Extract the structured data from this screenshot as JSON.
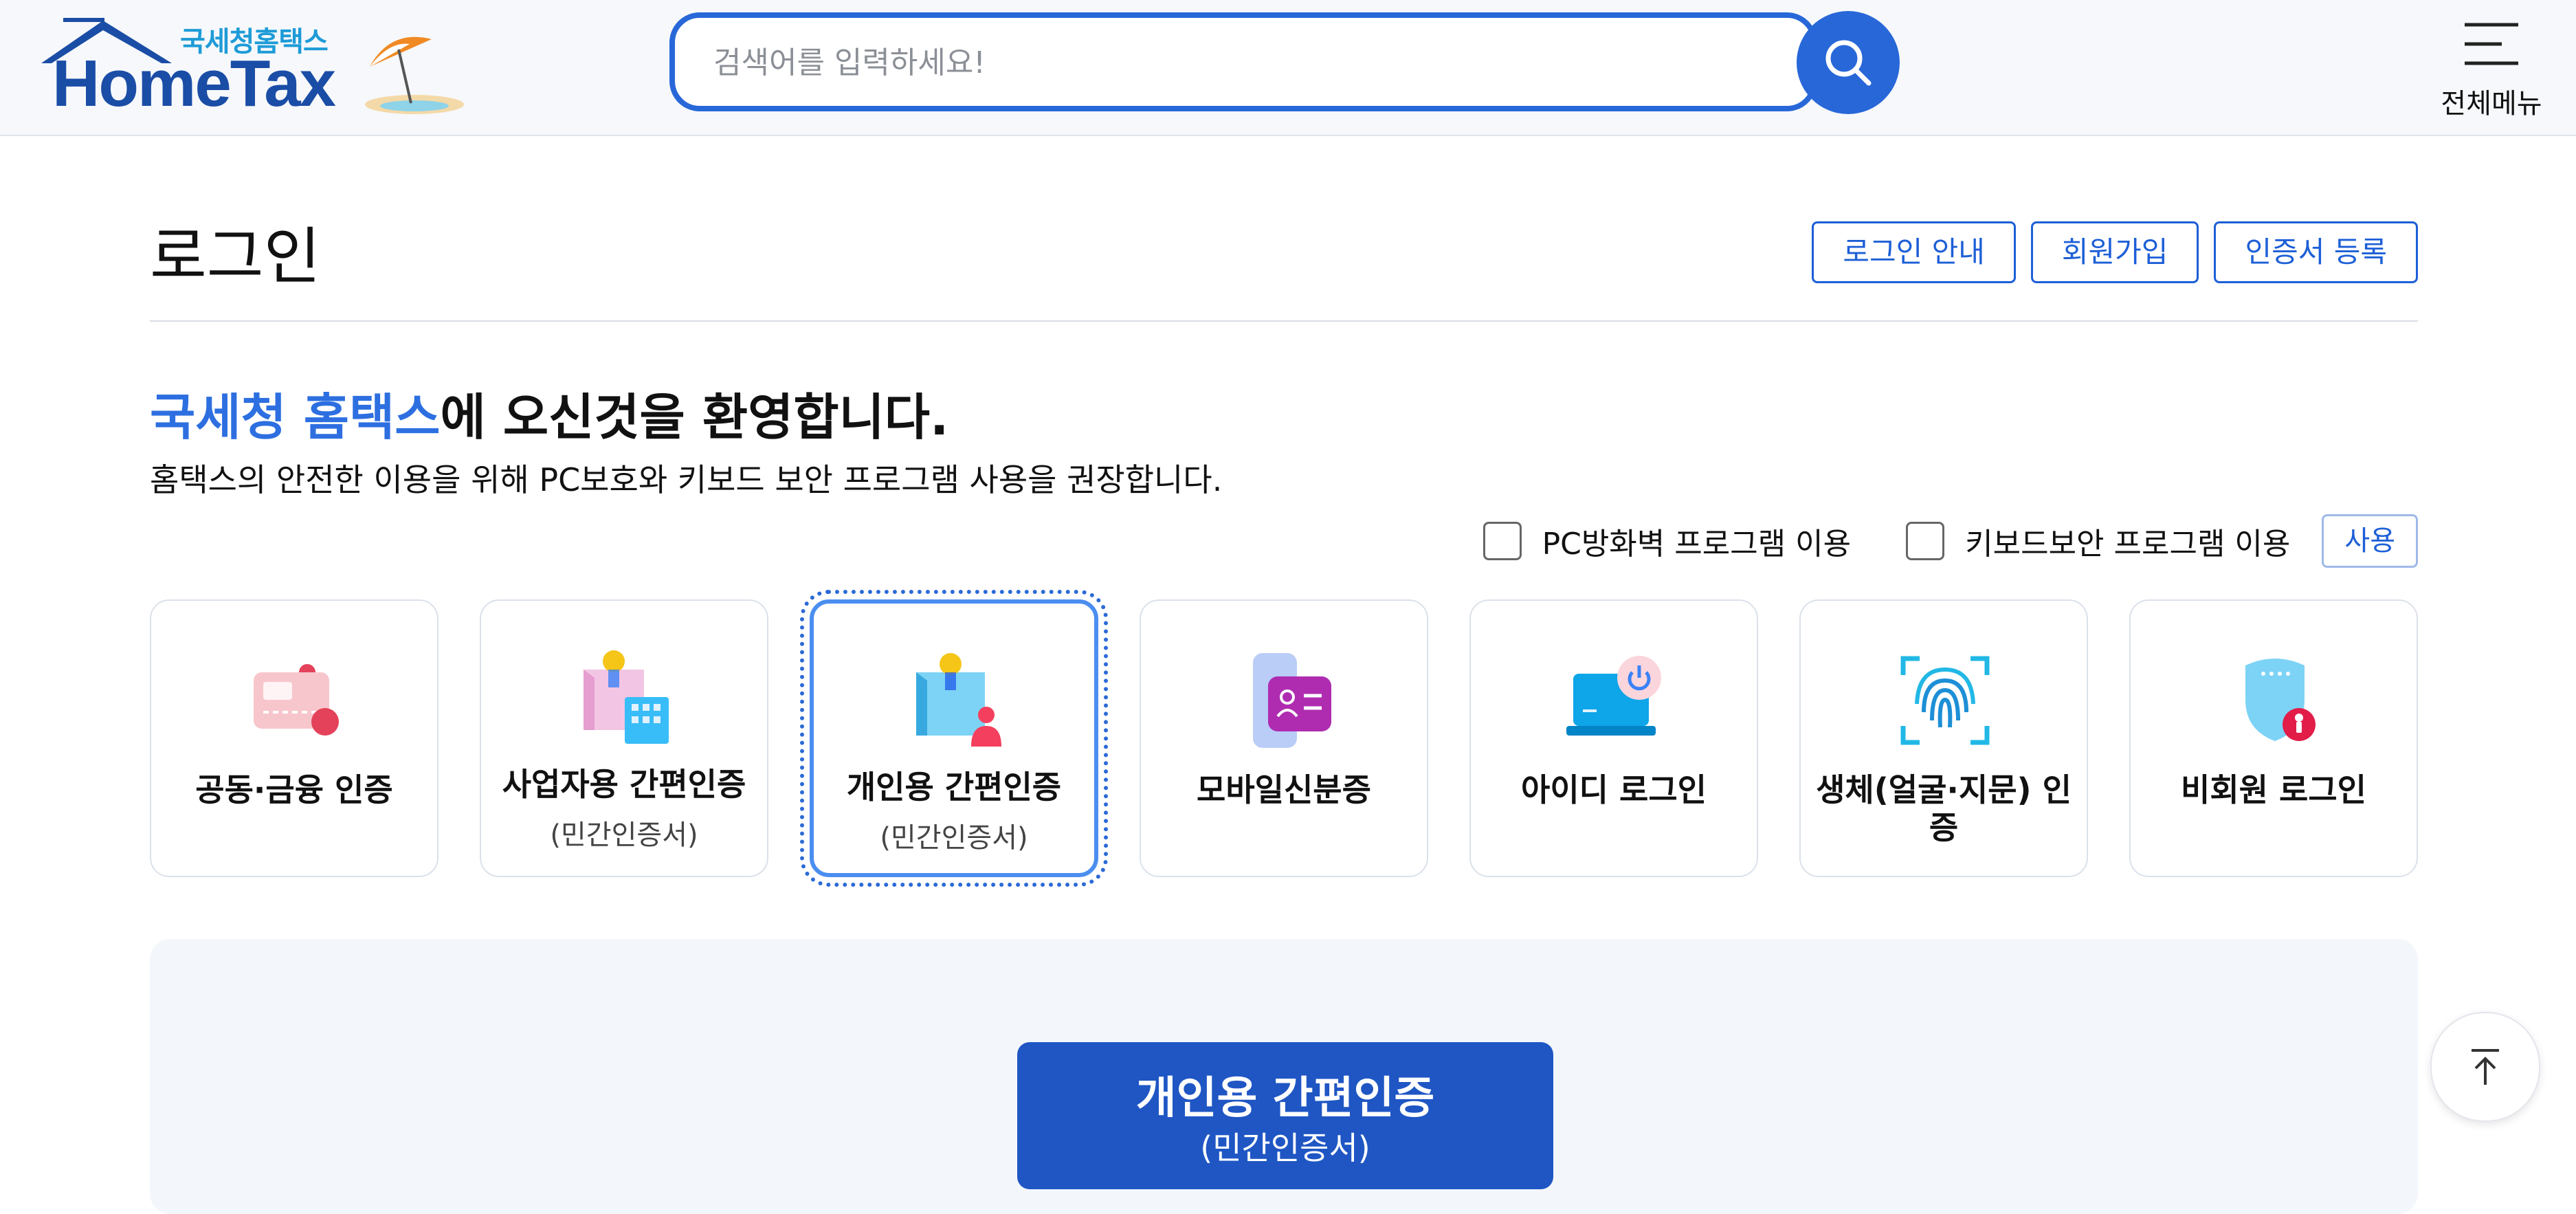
{
  "header": {
    "logo_sub": "국세청홈택스",
    "logo_main": "HomeTax",
    "search_placeholder": "검색어를 입력하세요!",
    "menu_label": "전체메뉴"
  },
  "page": {
    "title": "로그인",
    "links": [
      "로그인 안내",
      "회원가입",
      "인증서 등록"
    ],
    "welcome_brand": "국세청 홈택스",
    "welcome_rest": "에 오신것을 환영합니다.",
    "recommend": "홈택스의 안전한 이용을 위해 PC보호와 키보드 보안 프로그램 사용을 권장합니다."
  },
  "options": {
    "firewall_label": "PC방화벽 프로그램 이용",
    "firewall_checked": false,
    "keyboard_label": "키보드보안 프로그램 이용",
    "keyboard_checked": false,
    "use_button": "사용"
  },
  "methods": [
    {
      "label": "공동·금융 인증",
      "sub": "",
      "icon": "card-certificate-icon"
    },
    {
      "label": "사업자용 간편인증",
      "sub": "(민간인증서)",
      "icon": "business-building-icon"
    },
    {
      "label": "개인용 간편인증",
      "sub": "(민간인증서)",
      "icon": "personal-user-icon",
      "selected": true
    },
    {
      "label": "모바일신분증",
      "sub": "",
      "icon": "mobile-id-icon"
    },
    {
      "label": "아이디 로그인",
      "sub": "",
      "icon": "laptop-power-icon"
    },
    {
      "label": "생체(얼굴·지문) 인증",
      "sub": "",
      "icon": "fingerprint-icon"
    },
    {
      "label": "비회원 로그인",
      "sub": "",
      "icon": "shield-person-icon"
    }
  ],
  "action": {
    "title": "개인용 간편인증",
    "sub": "(민간인증서)"
  },
  "colors": {
    "accent": "#2867d8",
    "logo_blue": "#1a4da6",
    "brand_text": "#2d6fe0",
    "action_button": "#1f56c4"
  }
}
